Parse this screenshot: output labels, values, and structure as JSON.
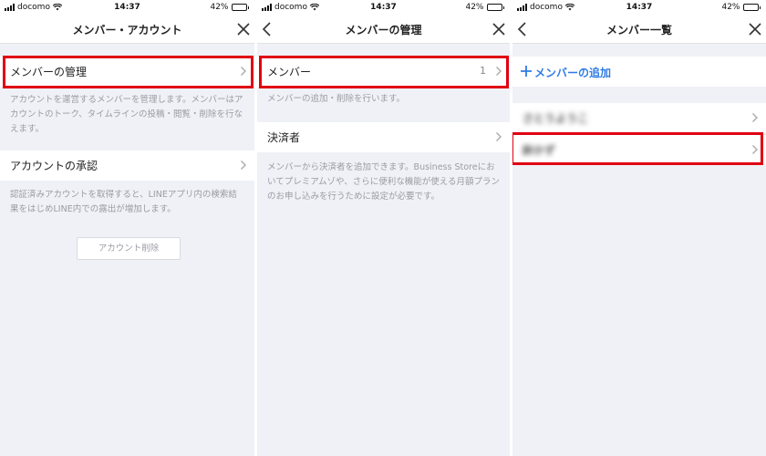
{
  "status": {
    "carrier": "docomo",
    "time": "14:37",
    "battery": "42%",
    "battery_level": 0.42
  },
  "screen1": {
    "title": "メンバー・アカウント",
    "member_management": "メンバーの管理",
    "member_management_desc": "アカウントを運営するメンバーを管理します。メンバーはアカウントのトーク、タイムラインの投稿・閲覧・削除を行なえます。",
    "account_approval": "アカウントの承認",
    "account_approval_desc": "認証済みアカウントを取得すると、LINEアプリ内の検索結果をはじめLINE内での露出が増加します。",
    "delete_button": "アカウント削除"
  },
  "screen2": {
    "title": "メンバーの管理",
    "members": "メンバー",
    "members_count": "1",
    "members_desc": "メンバーの追加・削除を行います。",
    "payer": "決済者",
    "payer_desc": "メンバーから決済者を追加できます。Business Storeにおいてプレミアムゾや、さらに便利な機能が使える月額プランのお申し込みを行うために設定が必要です。"
  },
  "screen3": {
    "title": "メンバー一覧",
    "add_member": "メンバーの追加",
    "member_rows": [
      "さとうようこ",
      "鈴かず"
    ]
  },
  "colors": {
    "highlight": "#e00012",
    "link": "#2f7be5",
    "background": "#eff1f6"
  },
  "icons": [
    "signal-icon",
    "wifi-icon",
    "battery-icon",
    "close-icon",
    "back-icon",
    "chevron-right-icon",
    "plus-icon"
  ]
}
